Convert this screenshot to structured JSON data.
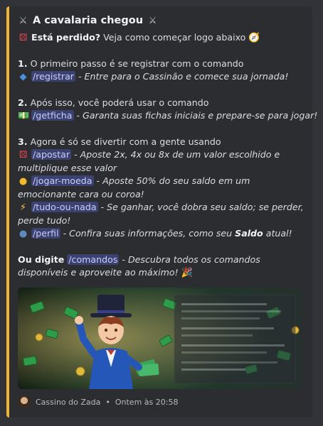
{
  "embed": {
    "title": "A cavalaria chegou",
    "accent_color": "#f0b232",
    "intro": {
      "bold": "Está perdido?",
      "text": " Veja como começar logo abaixo"
    },
    "step1": {
      "heading_num": "1.",
      "heading_text": " O primeiro passo é se registrar com o comando",
      "command": "/registrar",
      "desc": " - Entre para o Cassinão e comece sua jornada!"
    },
    "step2": {
      "heading_num": "2.",
      "heading_text": " Após isso, você poderá usar o comando",
      "command": "/getficha",
      "desc": " - Garanta suas fichas iniciais e prepare-se para jogar!"
    },
    "step3": {
      "heading_num": "3.",
      "heading_text": " Agora é só se divertir com a gente usando",
      "commands": [
        {
          "command": "/apostar",
          "desc": " - Aposte 2x, 4x ou 8x de um valor escolhido e multiplique esse valor"
        },
        {
          "command": "/jogar-moeda",
          "desc": " - Aposte 50% do seu saldo em um emocionante cara ou coroa!"
        },
        {
          "command": "/tudo-ou-nada",
          "desc": " - Se ganhar, você dobra seu saldo; se perder, perde tudo!"
        },
        {
          "command": "/perfil",
          "desc": " - Confira suas informações, como seu ",
          "desc_bold": "Saldo",
          "desc_end": " atual!"
        }
      ]
    },
    "closing": {
      "bold": "Ou digite",
      "command": "/comandos",
      "desc": " - Descubra todos os comandos disponíveis e aproveite ao máximo!"
    },
    "footer": {
      "author": "Cassino do Zada",
      "timestamp": "Ontem às 20:58"
    }
  }
}
